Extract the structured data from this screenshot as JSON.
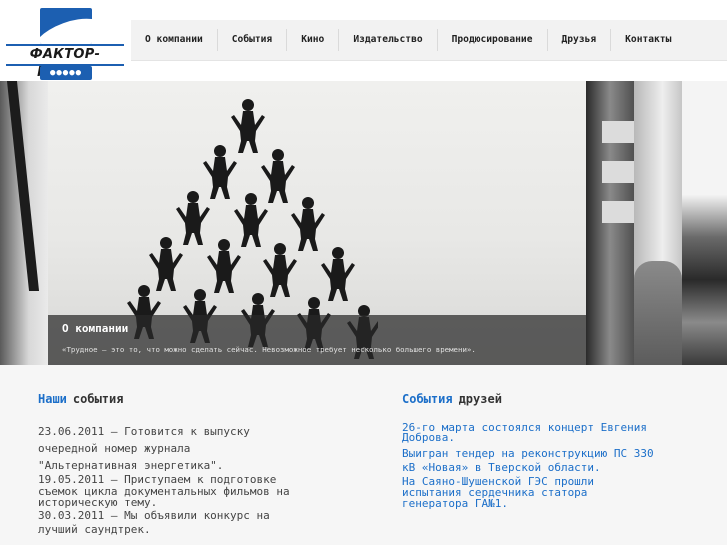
{
  "header": {
    "logo_text": "ФАКТОР-МЕДИА",
    "logo_dots": "●●●●●"
  },
  "nav": {
    "items": [
      {
        "label": "О компании"
      },
      {
        "label": "События"
      },
      {
        "label": "Кино"
      },
      {
        "label": "Издательство"
      },
      {
        "label": "Продюсирование"
      },
      {
        "label": "Друзья"
      },
      {
        "label": "Контакты"
      }
    ]
  },
  "banner": {
    "caption_title": "О компании",
    "caption_quote": "«Трудное – это то, что можно сделать сейчас. Невозможное требует несколько большего времени»."
  },
  "our_events": {
    "heading_highlight": "Наши",
    "heading_rest": "события",
    "items": [
      {
        "line1": "23.06.2011 – Готовится к выпуску",
        "line2": "очередной номер журнала",
        "line3": "\"Альтернативная энергетика\"."
      },
      {
        "line1": "19.05.2011 – Приступаем к подготовке",
        "line2": "съемок цикла документальных фильмов на",
        "line3": "историческую тему."
      },
      {
        "line1": "30.03.2011 – Мы объявили конкурс на",
        "line2": "лучший саундтрек.",
        "line3": ""
      }
    ]
  },
  "friend_events": {
    "heading_highlight": "События",
    "heading_rest": "друзей",
    "items": [
      {
        "line1": "26-го марта состоялся концерт Евгения",
        "line2": "Доброва."
      },
      {
        "line1": "Выигран тендер на реконструкцию ПС 330",
        "line2": "кВ «Новая» в Тверской области."
      },
      {
        "line1": "На Саяно-Шушенской ГЭС прошли",
        "line2": "испытания сердечника статора",
        "line3": "генератора ГА№1."
      }
    ]
  },
  "colors": {
    "accent": "#1c6fc9",
    "logo_blue": "#1c5fb1"
  }
}
